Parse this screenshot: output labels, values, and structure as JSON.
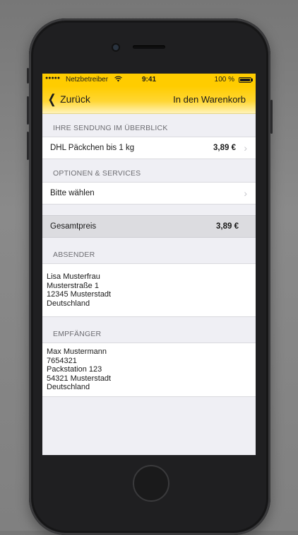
{
  "status_bar": {
    "carrier": "Netzbetreiber",
    "time": "9:41",
    "battery": "100 %"
  },
  "nav": {
    "back_label": "Zurück",
    "action_label": "In den Warenkorb"
  },
  "shipment": {
    "header": "IHRE SENDUNG IM ÜBERBLICK",
    "product": "DHL Päckchen bis 1 kg",
    "price": "3,89 €"
  },
  "options": {
    "header": "OPTIONEN & SERVICES",
    "placeholder": "Bitte wählen"
  },
  "total": {
    "label": "Gesamtpreis",
    "value": "3,89 €"
  },
  "sender": {
    "header": "ABSENDER",
    "lines": [
      "Lisa Musterfrau",
      "Musterstraße 1",
      "12345 Musterstadt",
      "Deutschland"
    ]
  },
  "recipient": {
    "header": "EMPFÄNGER",
    "lines": [
      "Max Mustermann",
      "7654321",
      "Packstation 123",
      "54321 Musterstadt",
      "Deutschland"
    ]
  },
  "colors": {
    "accent": "#ffcc00",
    "background": "#efeff4"
  }
}
